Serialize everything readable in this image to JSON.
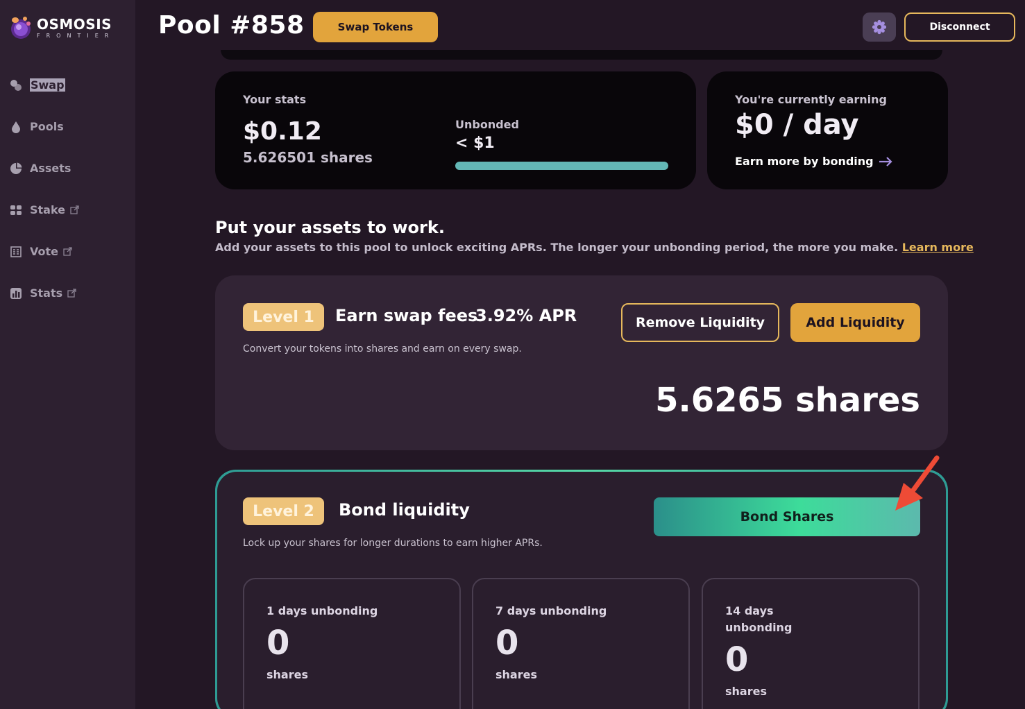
{
  "brand": {
    "title": "OSMOSIS",
    "subtitle": "FRONTIER"
  },
  "sidebar": {
    "items": [
      {
        "label": "Swap",
        "icon": "swap-icon",
        "external": false,
        "active": true
      },
      {
        "label": "Pools",
        "icon": "pools-icon",
        "external": false
      },
      {
        "label": "Assets",
        "icon": "assets-icon",
        "external": false
      },
      {
        "label": "Stake",
        "icon": "stake-icon",
        "external": true
      },
      {
        "label": "Vote",
        "icon": "vote-icon",
        "external": true
      },
      {
        "label": "Stats",
        "icon": "stats-icon",
        "external": true
      }
    ]
  },
  "header": {
    "title": "Pool #858",
    "swap_button": "Swap Tokens",
    "settings_icon": "gear-icon",
    "disconnect_button": "Disconnect"
  },
  "stats": {
    "label": "Your stats",
    "value": "$0.12",
    "shares": "5.626501 shares",
    "unbonded_label": "Unbonded",
    "unbonded_value": "< $1",
    "unbonded_progress": 1.0
  },
  "earning": {
    "label": "You're currently earning",
    "value": "$0 / day",
    "link": "Earn more by bonding"
  },
  "section": {
    "title": "Put your assets to work.",
    "description": "Add your assets to this pool to unlock exciting APRs. The longer your unbonding period, the more you make.",
    "learn_more": "Learn more"
  },
  "level1": {
    "badge": "Level 1",
    "title": "Earn swap fees",
    "apr": "3.92% APR",
    "description": "Convert your tokens into shares and earn on every swap.",
    "remove_button": "Remove Liquidity",
    "add_button": "Add Liquidity",
    "shares": "5.6265 shares"
  },
  "level2": {
    "badge": "Level 2",
    "title": "Bond liquidity",
    "description": "Lock up your shares for longer durations to earn higher APRs.",
    "bond_button": "Bond Shares",
    "durations": [
      {
        "title": "1 days unbonding",
        "value": "0",
        "unit": "shares"
      },
      {
        "title": "7 days unbonding",
        "value": "0",
        "unit": "shares"
      },
      {
        "title": "14 days unbonding",
        "value": "0",
        "unit": "shares"
      }
    ]
  },
  "colors": {
    "background": "#231725",
    "sidebar": "#2d2030",
    "accent": "#e2a43c",
    "teal": "#3ddc9a",
    "annotation_arrow": "#ee4b36"
  }
}
